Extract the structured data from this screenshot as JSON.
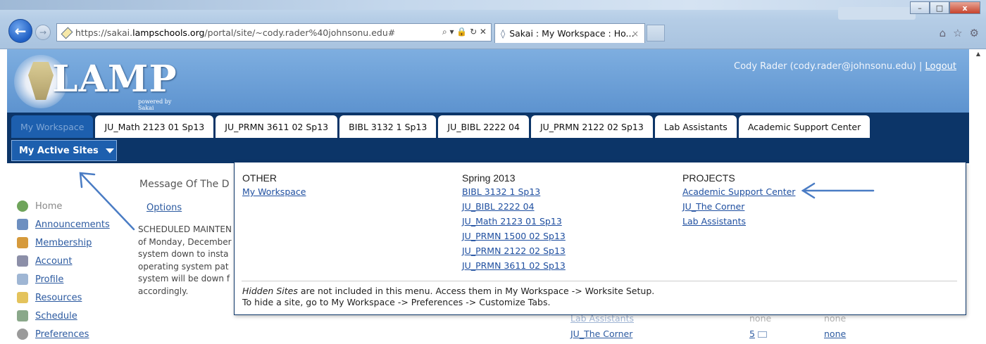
{
  "browser": {
    "url_prefix": "https://sakai.",
    "url_host": "lampschools.org",
    "url_path": "/portal/site/~cody.rader%40johnsonu.edu#",
    "tab_title": "Sakai : My Workspace : Ho...",
    "tab_close": "×",
    "address_tools": "⌕ ▾ 🔒 ↻ ✕",
    "window_controls": {
      "min": "–",
      "max": "□",
      "close": "x"
    },
    "right_icons": [
      "⌂",
      "☆",
      "⚙"
    ]
  },
  "header": {
    "logo_text": "LAMP",
    "logo_subtitle": "powered by Sakai",
    "user_text": "Cody Rader (cody.rader@johnsonu.edu)",
    "separator": " | ",
    "logout": "Logout"
  },
  "site_tabs": [
    {
      "label": "My Workspace",
      "selected": true
    },
    {
      "label": "JU_Math 2123 01 Sp13"
    },
    {
      "label": "JU_PRMN 3611 02 Sp13"
    },
    {
      "label": "BIBL 3132 1 Sp13"
    },
    {
      "label": "JU_BIBL 2222 04"
    },
    {
      "label": "JU_PRMN 2122 02 Sp13"
    },
    {
      "label": "Lab Assistants"
    },
    {
      "label": "Academic Support Center"
    }
  ],
  "active_sites_label": "My Active Sites",
  "tools": [
    {
      "label": "Home",
      "icon": "home-icon",
      "color": "#6fa45b",
      "current": true
    },
    {
      "label": "Announcements",
      "icon": "announcements-icon",
      "color": "#6d8fc0"
    },
    {
      "label": "Membership",
      "icon": "membership-icon",
      "color": "#d69a3c"
    },
    {
      "label": "Account",
      "icon": "account-icon",
      "color": "#8c8fa8"
    },
    {
      "label": "Profile",
      "icon": "profile-icon",
      "color": "#9fb6d4"
    },
    {
      "label": "Resources",
      "icon": "folder-icon",
      "color": "#e4c35c"
    },
    {
      "label": "Schedule",
      "icon": "calendar-icon",
      "color": "#8aa88a"
    },
    {
      "label": "Preferences",
      "icon": "gear-icon",
      "color": "#9a9a9a"
    }
  ],
  "motd": {
    "title": "Message Of The D",
    "options": "Options",
    "lines": [
      "SCHEDULED MAINTEN",
      "of Monday, December",
      "system down to insta",
      "operating system pat",
      "system will be down f",
      "accordingly."
    ]
  },
  "dropdown": {
    "columns": [
      {
        "heading": "OTHER",
        "links": [
          "My Workspace"
        ]
      },
      {
        "heading": "Spring 2013",
        "links": [
          "BIBL 3132 1 Sp13",
          "JU_BIBL 2222 04",
          "JU_Math 2123 01 Sp13",
          "JU_PRMN 1500 02 Sp13",
          "JU_PRMN 2122 02 Sp13",
          "JU_PRMN 3611 02 Sp13"
        ]
      },
      {
        "heading": "PROJECTS",
        "links": [
          "Academic Support Center",
          "JU_The Corner",
          "Lab Assistants"
        ]
      }
    ],
    "note_em": "Hidden Sites",
    "note_line1_rest": " are not included in this menu. Access them in My Workspace -> Worksite Setup.",
    "note_line2": "To hide a site, go to My Workspace -> Preferences -> Customize Tabs."
  },
  "background_rows": [
    {
      "site": "Lab Assistants",
      "col2": "none",
      "col3": "none",
      "faded": true
    },
    {
      "site": "JU_The Corner",
      "col2": "5",
      "col3": "none"
    }
  ],
  "colors": {
    "header_blue": "#6b9fd8",
    "nav_navy": "#0c3568",
    "link_blue": "#1f4fa0",
    "arrow": "#4a7cc4"
  }
}
